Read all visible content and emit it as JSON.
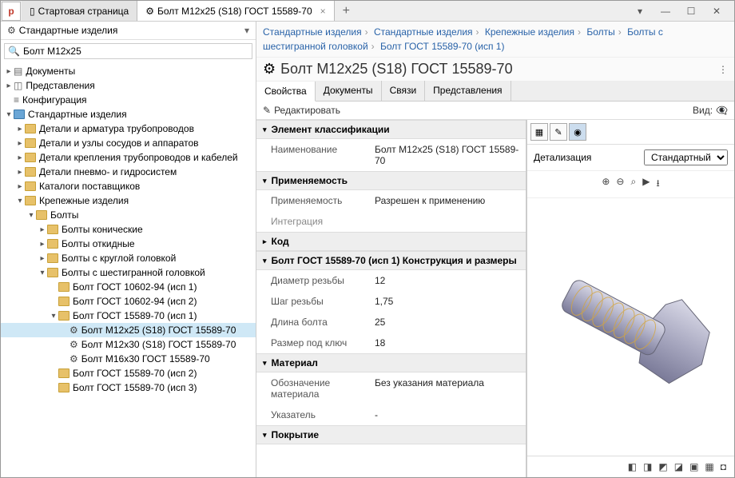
{
  "tabs": {
    "start": "Стартовая страница",
    "active": "Болт M12x25 (S18) ГОСТ 15589-70"
  },
  "left": {
    "header": "Стандартные изделия",
    "search": "Болт М12х25",
    "tree": {
      "docs": "Документы",
      "views": "Представления",
      "config": "Конфигурация",
      "std": "Стандартные изделия",
      "n1": "Детали и арматура трубопроводов",
      "n2": "Детали и узлы сосудов и аппаратов",
      "n3": "Детали крепления трубопроводов и кабелей",
      "n4": "Детали пневмо- и гидросистем",
      "n5": "Каталоги поставщиков",
      "n6": "Крепежные изделия",
      "n7": "Болты",
      "n8": "Болты конические",
      "n9": "Болты откидные",
      "n10": "Болты с круглой головкой",
      "n11": "Болты с шестигранной головкой",
      "n12": "Болт ГОСТ 10602-94 (исп 1)",
      "n13": "Болт ГОСТ 10602-94 (исп 2)",
      "n14": "Болт ГОСТ 15589-70 (исп 1)",
      "n15": "Болт M12x25 (S18) ГОСТ 15589-70",
      "n16": "Болт M12x30 (S18) ГОСТ 15589-70",
      "n17": "Болт M16x30 ГОСТ 15589-70",
      "n18": "Болт ГОСТ 15589-70 (исп 2)",
      "n19": "Болт ГОСТ 15589-70 (исп 3)"
    }
  },
  "crumbs": {
    "c1": "Стандартные изделия",
    "c2": "Стандартные изделия",
    "c3": "Крепежные изделия",
    "c4": "Болты",
    "c5": "Болты с шестигранной головкой",
    "c6": "Болт ГОСТ 15589-70 (исп 1)"
  },
  "title": "Болт M12x25 (S18) ГОСТ 15589-70",
  "subtabs": {
    "t1": "Свойства",
    "t2": "Документы",
    "t3": "Связи",
    "t4": "Представления"
  },
  "toolbar": {
    "edit": "Редактировать",
    "view": "Вид:"
  },
  "sections": {
    "s1": "Элемент классификации",
    "s2": "Применяемость",
    "s2sub": "Интеграция",
    "s3": "Код",
    "s4": "Болт ГОСТ 15589-70 (исп 1) Конструкция и размеры",
    "s5": "Материал",
    "s6": "Покрытие"
  },
  "props": {
    "name_k": "Наименование",
    "name_v": "Болт M12x25 (S18) ГОСТ 15589-70",
    "use_k": "Применяемость",
    "use_v": "Разрешен к применению",
    "dia_k": "Диаметр резьбы",
    "dia_v": "12",
    "pitch_k": "Шаг резьбы",
    "pitch_v": "1,75",
    "len_k": "Длина болта",
    "len_v": "25",
    "key_k": "Размер под ключ",
    "key_v": "18",
    "mat_k": "Обозначение материала",
    "mat_v": "Без указания материала",
    "ptr_k": "Указатель",
    "ptr_v": "-"
  },
  "preview": {
    "detail": "Детализация",
    "mode": "Стандартный"
  }
}
